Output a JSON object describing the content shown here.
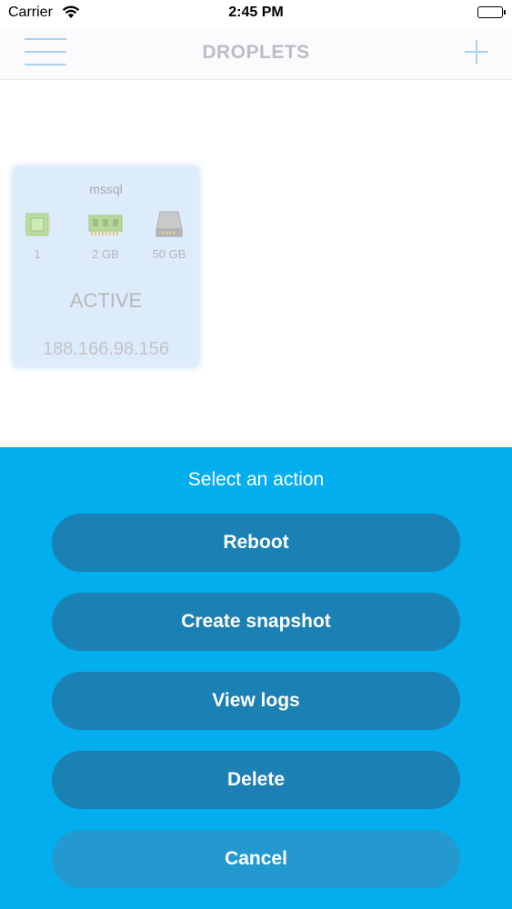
{
  "status_bar": {
    "carrier": "Carrier",
    "time": "2:45 PM",
    "wifi_icon": "wifi-icon",
    "battery_icon": "battery-icon"
  },
  "nav": {
    "title": "DROPLETS",
    "menu_icon": "hamburger-menu-icon",
    "add_icon": "plus-icon",
    "accent_color": "#a7d3f2"
  },
  "droplet": {
    "name": "mssql",
    "cpu": "1",
    "memory": "2 GB",
    "disk": "50 GB",
    "status": "ACTIVE",
    "ip": "188.166.98.156",
    "cpu_icon": "cpu-chip-icon",
    "memory_icon": "ram-stick-icon",
    "disk_icon": "hard-drive-icon"
  },
  "action_sheet": {
    "title": "Select an action",
    "background": "#02aeed",
    "button_color": "#1b80b3",
    "actions": [
      {
        "label": "Reboot"
      },
      {
        "label": "Create snapshot"
      },
      {
        "label": "View logs"
      },
      {
        "label": "Delete"
      }
    ],
    "cancel_label": "Cancel"
  }
}
